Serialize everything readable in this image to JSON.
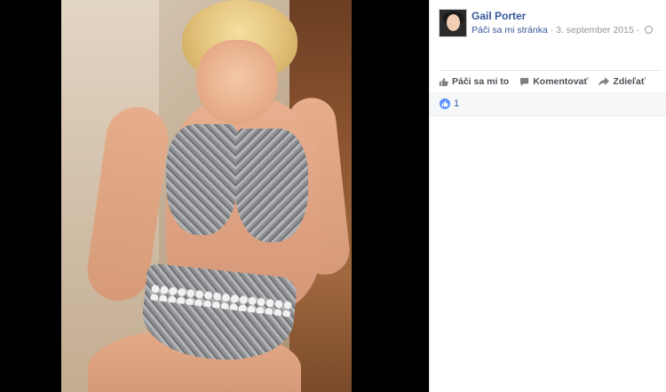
{
  "post": {
    "author": "Gail Porter",
    "like_page": "Páči sa mi stránka",
    "separator": " · ",
    "date": "3. september 2015",
    "separator2": " · "
  },
  "actions": {
    "like": "Páči sa mi to",
    "comment": "Komentovať",
    "share": "Zdieľať"
  },
  "reactions": {
    "count": "1"
  },
  "colors": {
    "link": "#365899",
    "like_bubble": "#5890ff",
    "meta": "#90949c"
  },
  "icons": {
    "like": "thumbs-up-icon",
    "comment": "comment-icon",
    "share": "share-icon",
    "audience": "globe-icon",
    "reaction": "like-reaction-icon"
  }
}
